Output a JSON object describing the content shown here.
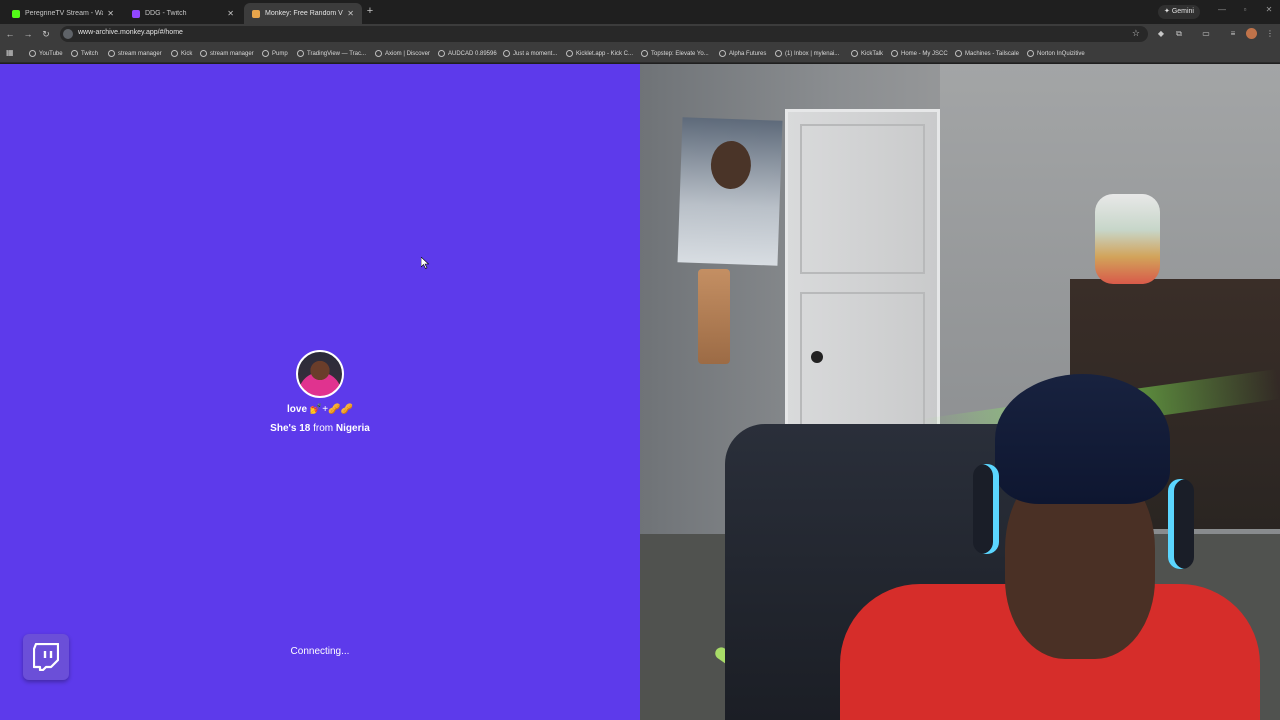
{
  "browser": {
    "tabs": [
      {
        "title": "PeregrineTV Stream - Watch Li",
        "favicon_color": "#53fc18",
        "active": false
      },
      {
        "title": "DDG - Twitch",
        "favicon_color": "#9146ff",
        "active": false
      },
      {
        "title": "Monkey: Free Random Vide",
        "favicon_color": "#e8a54b",
        "active": true
      }
    ],
    "new_tab": "+",
    "gemini_label": "Gemini",
    "url": "www-archive.monkey.app/#/home",
    "bookmarks": [
      "YouTube",
      "Twitch",
      "stream manager",
      "Kick",
      "stream manager",
      "Pump",
      "TradingView — Trac...",
      "Axiom | Discover",
      "AUDCAD 0.89596",
      "Just a moment...",
      "Kicklet.app - Kick C...",
      "Topstep: Elevate Yo...",
      "Alpha Futures",
      "(1) Inbox | mylenai...",
      "KickTalk",
      "Home - My JSCC",
      "Machines - Tailscale",
      "Norton InQuizitive"
    ]
  },
  "match": {
    "name": "love",
    "name_emoji": "💅+🥜🥜",
    "info_prefix": "She's",
    "age": "18",
    "info_mid": "from",
    "country": "Nigeria",
    "status": "Connecting..."
  },
  "colors": {
    "left_bg": "#5d3aeb",
    "twitch_btn": "#6b4fd8"
  }
}
